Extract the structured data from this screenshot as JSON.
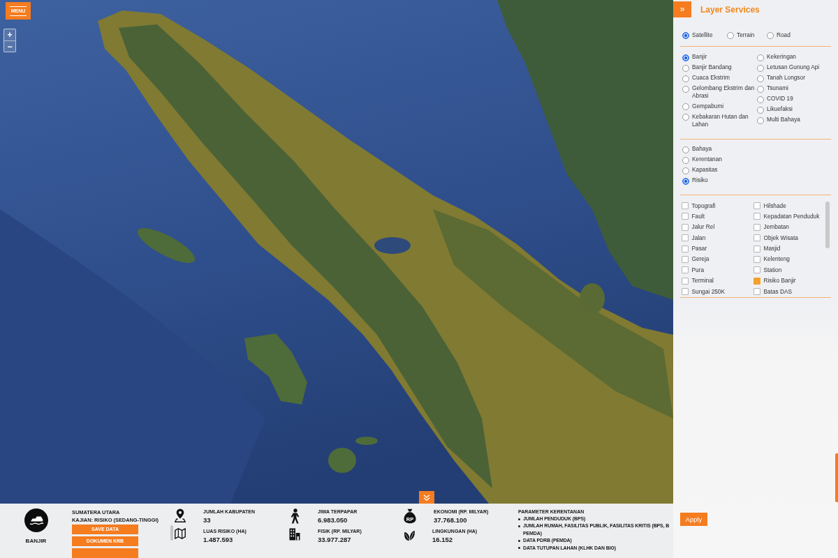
{
  "map": {
    "menu_button": "MENU",
    "zoom_controls": [
      "+",
      "−"
    ]
  },
  "layer_panel": {
    "toggle": "»",
    "title": "Layer Services",
    "basemaps": [
      {
        "label": "Satellite",
        "selected": true
      },
      {
        "label": "Terrain",
        "selected": false
      },
      {
        "label": "Road",
        "selected": false
      }
    ],
    "hazard_columns": [
      {
        "items": [
          {
            "label": "Banjir",
            "selected": true
          },
          {
            "label": "Banjir Bandang",
            "selected": false
          },
          {
            "label": "Cuaca Ekstrim",
            "selected": false
          },
          {
            "label": "Gelombang Ekstrim dan Abrasi",
            "selected": false
          },
          {
            "label": "Gempabumi",
            "selected": false
          },
          {
            "label": "Kebakaran Hutan dan Lahan",
            "selected": false
          }
        ]
      },
      {
        "items": [
          {
            "label": "Kekeringan",
            "selected": false
          },
          {
            "label": "Letusan Gunung Api",
            "selected": false
          },
          {
            "label": "Tanah Longsor",
            "selected": false
          },
          {
            "label": "Tsunami",
            "selected": false
          },
          {
            "label": "COVID 19",
            "selected": false
          },
          {
            "label": "Likuefaksi",
            "selected": false
          },
          {
            "label": "Multi Bahaya",
            "selected": false
          }
        ]
      }
    ],
    "assessment_types": [
      {
        "label": "Bahaya",
        "selected": false
      },
      {
        "label": "Kerentanan",
        "selected": false
      },
      {
        "label": "Kapasitas",
        "selected": false
      },
      {
        "label": "Risiko",
        "selected": true
      }
    ],
    "layers": [
      {
        "label": "Topografi",
        "checked": false
      },
      {
        "label": "Hilshade",
        "checked": false
      },
      {
        "label": "Fault",
        "checked": false
      },
      {
        "label": "Kepadatan Penduduk",
        "checked": false
      },
      {
        "label": "Jalur Rel",
        "checked": false
      },
      {
        "label": "Jembatan",
        "checked": false
      },
      {
        "label": "Jalan",
        "checked": false
      },
      {
        "label": "Objek Wisata",
        "checked": false
      },
      {
        "label": "Pasar",
        "checked": false
      },
      {
        "label": "Masjid",
        "checked": false
      },
      {
        "label": "Gereja",
        "checked": false
      },
      {
        "label": "Kelenteng",
        "checked": false
      },
      {
        "label": "Pura",
        "checked": false
      },
      {
        "label": "Station",
        "checked": false
      },
      {
        "label": "Terminal",
        "checked": false
      },
      {
        "label": "Risiko Banjir",
        "checked": true
      },
      {
        "label": "Sungai 250K",
        "checked": false
      },
      {
        "label": "Batas DAS",
        "checked": false
      }
    ],
    "apply_button": "Apply"
  },
  "summary_bar": {
    "hazard": "BANJIR",
    "region": "SUMATERA UTARA",
    "assessment": "KAJIAN: RISIKO (SEDANG-TINGGI)",
    "buttons": [
      {
        "kind": "full",
        "label": "SAVE DATA"
      },
      {
        "kind": "full",
        "label": "DOKUMEN KRB"
      },
      {
        "kind": "cut"
      }
    ],
    "stat_columns": [
      {
        "items": [
          {
            "kind": "pin",
            "label": "JUMLAH KABUPATEN",
            "value": "33"
          },
          {
            "kind": "map",
            "label": "LUAS RISIKO (HA)",
            "value": "1.487.593"
          }
        ]
      },
      {
        "items": [
          {
            "kind": "person",
            "label": "JIWA TERPAPAR",
            "value": "6.983.050"
          },
          {
            "kind": "building",
            "label": "FISIK (RP. MILYAR)",
            "value": "33.977.287"
          }
        ]
      },
      {
        "items": [
          {
            "kind": "money",
            "label": "EKONOMI (RP. MILYAR)",
            "value": "37.768.100",
            "icon_text": "RP"
          },
          {
            "kind": "leaves",
            "label": "LINGKUNGAN (HA)",
            "value": "16.152"
          }
        ]
      }
    ],
    "parameters": {
      "title": "PARAMETER KERENTANAN",
      "items": [
        {
          "lines": [
            "JUMLAH PENDUDUK (BPS)"
          ]
        },
        {
          "lines": [
            "JUMLAH RUMAH, FASILITAS PUBLIK, FASILITAS KRITIS (BPS, B",
            "PEMDA)"
          ]
        },
        {
          "lines": [
            "DATA PDRB (PEMDA)"
          ]
        },
        {
          "lines": [
            "DATA TUTUPAN LAHAN (KLHK DAN BIG)"
          ]
        }
      ]
    }
  }
}
